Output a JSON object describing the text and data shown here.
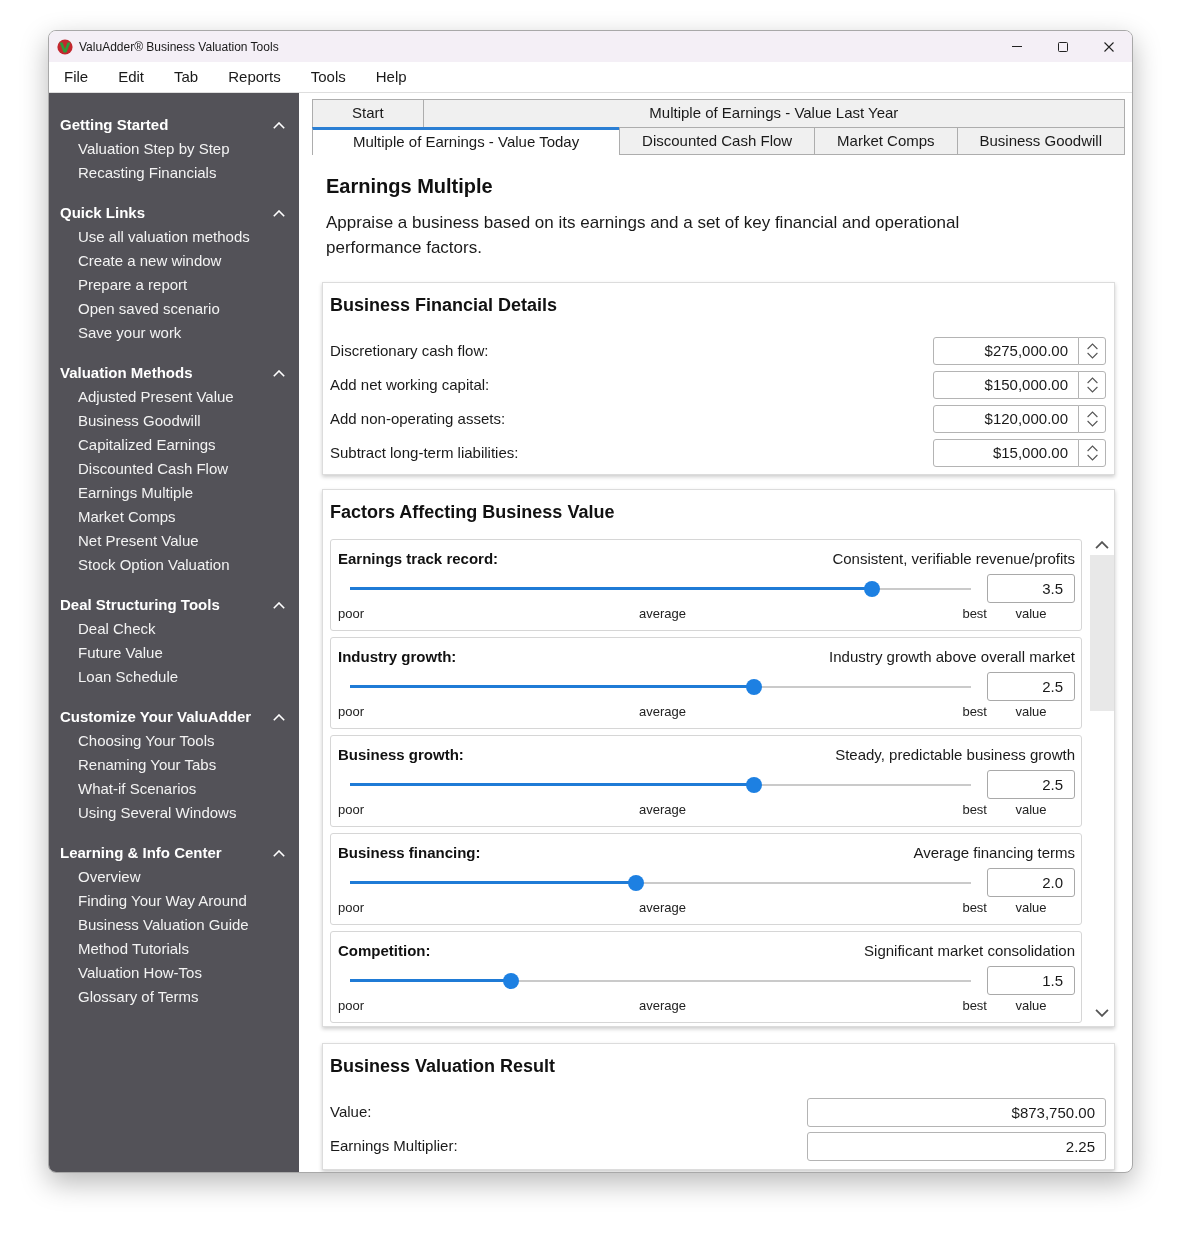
{
  "window": {
    "title": "ValuAdder® Business Valuation Tools"
  },
  "menu": [
    "File",
    "Edit",
    "Tab",
    "Reports",
    "Tools",
    "Help"
  ],
  "sidebar": {
    "sections": [
      {
        "title": "Getting Started",
        "expanded": true,
        "items": [
          "Valuation Step by Step",
          "Recasting Financials"
        ]
      },
      {
        "title": "Quick Links",
        "expanded": true,
        "items": [
          "Use all valuation methods",
          "Create a new window",
          "Prepare a report",
          "Open saved scenario",
          "Save your work"
        ]
      },
      {
        "title": "Valuation Methods",
        "expanded": true,
        "items": [
          "Adjusted Present Value",
          "Business Goodwill",
          "Capitalized Earnings",
          "Discounted Cash Flow",
          "Earnings Multiple",
          "Market Comps",
          "Net Present Value",
          "Stock Option Valuation"
        ]
      },
      {
        "title": "Deal Structuring Tools",
        "expanded": true,
        "items": [
          "Deal Check",
          "Future Value",
          "Loan Schedule"
        ]
      },
      {
        "title": "Customize Your ValuAdder",
        "expanded": true,
        "items": [
          "Choosing Your Tools",
          "Renaming Your Tabs",
          "What-if Scenarios",
          "Using Several Windows"
        ]
      },
      {
        "title": "Learning & Info Center",
        "expanded": true,
        "items": [
          "Overview",
          "Finding Your Way Around",
          "Business Valuation Guide",
          "Method Tutorials",
          "Valuation How-Tos",
          "Glossary of Terms"
        ]
      }
    ]
  },
  "tab_rows": [
    [
      {
        "label": "Start",
        "selected": false
      },
      {
        "label": "Multiple of Earnings - Value Last Year",
        "selected": false
      }
    ],
    [
      {
        "label": "Multiple of Earnings - Value Today",
        "selected": true
      },
      {
        "label": "Discounted Cash Flow",
        "selected": false
      },
      {
        "label": "Market Comps",
        "selected": false
      },
      {
        "label": "Business Goodwill",
        "selected": false
      }
    ]
  ],
  "page": {
    "title": "Earnings Multiple",
    "description": "Appraise a business based on its earnings and a set of key financial and operational performance factors."
  },
  "financial_details": {
    "title": "Business Financial Details",
    "fields": [
      {
        "label": "Discretionary cash flow:",
        "value": "$275,000.00"
      },
      {
        "label": "Add net working capital:",
        "value": "$150,000.00"
      },
      {
        "label": "Add non-operating assets:",
        "value": "$120,000.00"
      },
      {
        "label": "Subtract long-term liabilities:",
        "value": "$15,000.00"
      }
    ]
  },
  "factors": {
    "title": "Factors Affecting Business Value",
    "items": [
      {
        "label": "Earnings track record:",
        "description": "Consistent, verifiable revenue/profits",
        "level": 0.84,
        "value": "3.5",
        "scale_labels": [
          "poor",
          "average",
          "best"
        ],
        "value_caption": "value"
      },
      {
        "label": "Industry growth:",
        "description": "Industry growth above overall market",
        "level": 0.65,
        "value": "2.5",
        "scale_labels": [
          "poor",
          "average",
          "best"
        ],
        "value_caption": "value"
      },
      {
        "label": "Business growth:",
        "description": "Steady, predictable business growth",
        "level": 0.65,
        "value": "2.5",
        "scale_labels": [
          "poor",
          "average",
          "best"
        ],
        "value_caption": "value"
      },
      {
        "label": "Business financing:",
        "description": "Average financing terms",
        "level": 0.46,
        "value": "2.0",
        "scale_labels": [
          "poor",
          "average",
          "best"
        ],
        "value_caption": "value"
      },
      {
        "label": "Competition:",
        "description": "Significant market consolidation",
        "level": 0.26,
        "value": "1.5",
        "scale_labels": [
          "poor",
          "average",
          "best"
        ],
        "value_caption": "value"
      }
    ]
  },
  "result": {
    "title": "Business Valuation Result",
    "fields": [
      {
        "label": "Value:",
        "value": "$873,750.00"
      },
      {
        "label": "Earnings Multiplier:",
        "value": "2.25"
      }
    ]
  }
}
